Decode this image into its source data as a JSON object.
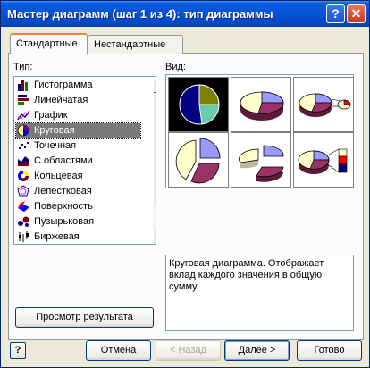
{
  "window": {
    "title": "Мастер диаграмм (шаг 1 из 4): тип диаграммы",
    "help_glyph": "?",
    "close_glyph": "✕"
  },
  "tabs": [
    {
      "label": "Стандартные",
      "active": true
    },
    {
      "label": "Нестандартные",
      "active": false
    }
  ],
  "type_label": "Тип:",
  "view_label": "Вид:",
  "chart_types": [
    {
      "label": "Гистограмма",
      "icon": "column-chart-icon"
    },
    {
      "label": "Линейчатая",
      "icon": "bar-chart-icon"
    },
    {
      "label": "График",
      "icon": "line-chart-icon"
    },
    {
      "label": "Круговая",
      "icon": "pie-chart-icon",
      "selected": true
    },
    {
      "label": "Точечная",
      "icon": "scatter-chart-icon"
    },
    {
      "label": "С областями",
      "icon": "area-chart-icon"
    },
    {
      "label": "Кольцевая",
      "icon": "doughnut-chart-icon"
    },
    {
      "label": "Лепестковая",
      "icon": "radar-chart-icon"
    },
    {
      "label": "Поверхность",
      "icon": "surface-chart-icon"
    },
    {
      "label": "Пузырьковая",
      "icon": "bubble-chart-icon"
    },
    {
      "label": "Биржевая",
      "icon": "stock-chart-icon"
    }
  ],
  "subtypes": [
    {
      "name": "pie-basic",
      "selected": true
    },
    {
      "name": "pie-3d"
    },
    {
      "name": "pie-of-pie"
    },
    {
      "name": "pie-exploded"
    },
    {
      "name": "pie-3d-exploded"
    },
    {
      "name": "bar-of-pie"
    }
  ],
  "description": "Круговая диаграмма. Отображает вклад каждого значения в общую сумму.",
  "buttons": {
    "preview": "Просмотр результата",
    "cancel": "Отмена",
    "back": "< Назад",
    "next": "Далее >",
    "finish": "Готово",
    "help": "?"
  },
  "colors": {
    "pie_blue": "#9999ff",
    "pie_purple": "#993366",
    "pie_cream": "#ffffcc",
    "pie_teal": "#66ccaa",
    "pie_navy": "#000080",
    "pie_olive": "#808000"
  }
}
